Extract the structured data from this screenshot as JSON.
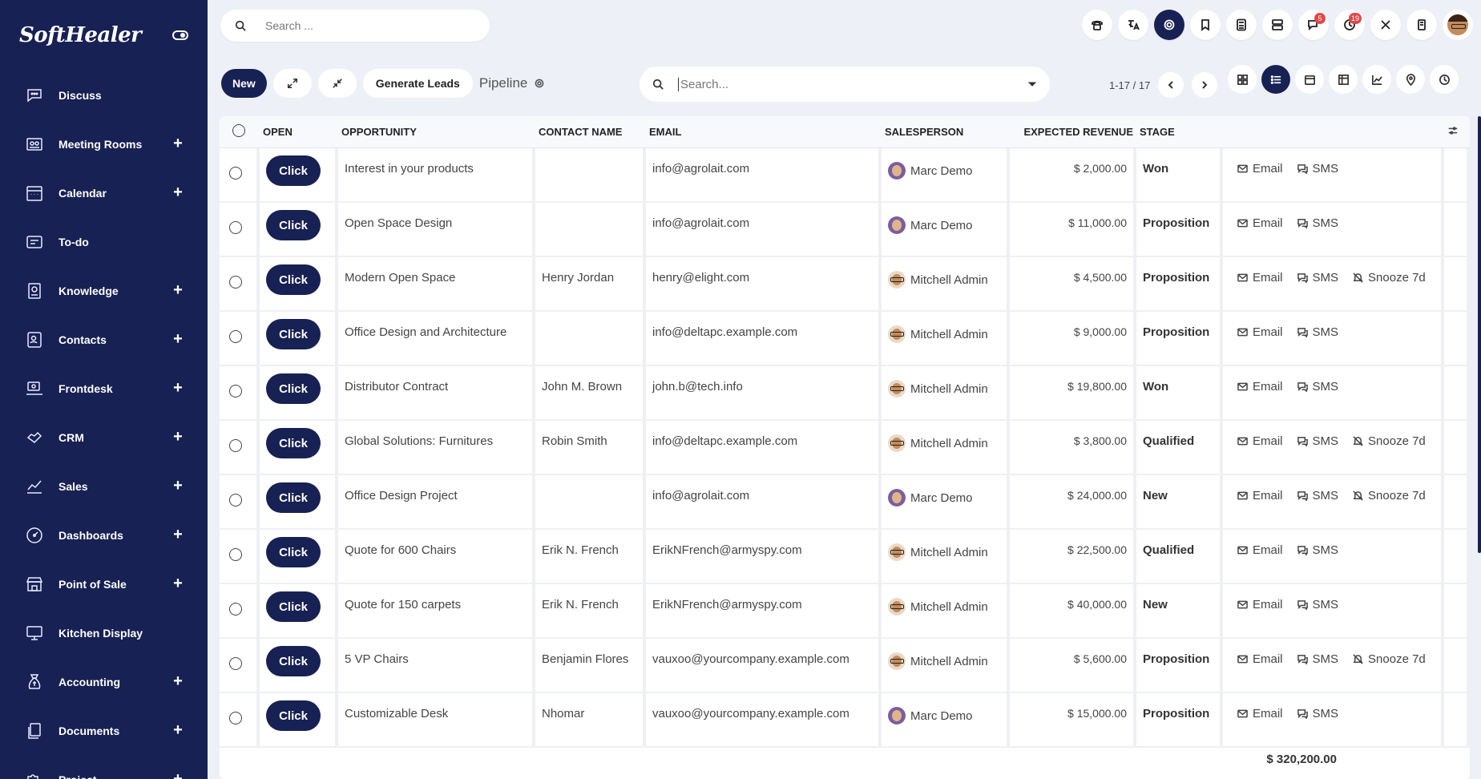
{
  "brand": {
    "logo": "SoftHealer"
  },
  "sidebar": {
    "items": [
      {
        "label": "Discuss",
        "icon": "chat-icon",
        "plus": false
      },
      {
        "label": "Meeting Rooms",
        "icon": "meeting-room-icon",
        "plus": true
      },
      {
        "label": "Calendar",
        "icon": "calendar-icon",
        "plus": true
      },
      {
        "label": "To-do",
        "icon": "todo-icon",
        "plus": false
      },
      {
        "label": "Knowledge",
        "icon": "knowledge-icon",
        "plus": true
      },
      {
        "label": "Contacts",
        "icon": "contacts-icon",
        "plus": true
      },
      {
        "label": "Frontdesk",
        "icon": "frontdesk-icon",
        "plus": true
      },
      {
        "label": "CRM",
        "icon": "crm-icon",
        "plus": true
      },
      {
        "label": "Sales",
        "icon": "sales-icon",
        "plus": true
      },
      {
        "label": "Dashboards",
        "icon": "dashboard-icon",
        "plus": true
      },
      {
        "label": "Point of Sale",
        "icon": "pos-icon",
        "plus": true
      },
      {
        "label": "Kitchen Display",
        "icon": "monitor-icon",
        "plus": false
      },
      {
        "label": "Accounting",
        "icon": "accounting-icon",
        "plus": true
      },
      {
        "label": "Documents",
        "icon": "documents-icon",
        "plus": true
      },
      {
        "label": "Project",
        "icon": "puzzle-icon",
        "plus": true
      }
    ],
    "plus_symbol": "+"
  },
  "topbar": {
    "search_placeholder": "Search ...",
    "badges": {
      "chat": "5",
      "activity": "19"
    }
  },
  "control": {
    "new_label": "New",
    "generate_leads_label": "Generate Leads",
    "pipeline_label": "Pipeline",
    "search_placeholder": "Search...",
    "pager_text": "1-17 / 17"
  },
  "table": {
    "headers": {
      "open": "OPEN",
      "opportunity": "OPPORTUNITY",
      "contact": "CONTACT NAME",
      "email": "EMAIL",
      "salesperson": "SALESPERSON",
      "revenue": "EXPECTED REVENUE",
      "stage": "STAGE"
    },
    "click_label": "Click",
    "action_labels": {
      "email": "Email",
      "sms": "SMS",
      "snooze": "Snooze 7d"
    },
    "rows": [
      {
        "opportunity": "Interest in your products",
        "contact": "",
        "email": "info@agrolait.com",
        "salesperson": "Marc Demo",
        "sp_type": "marc",
        "revenue": "$ 2,000.00",
        "stage": "Won",
        "snooze": false
      },
      {
        "opportunity": "Open Space Design",
        "contact": "",
        "email": "info@agrolait.com",
        "salesperson": "Marc Demo",
        "sp_type": "marc",
        "revenue": "$ 11,000.00",
        "stage": "Proposition",
        "snooze": false
      },
      {
        "opportunity": "Modern Open Space",
        "contact": "Henry Jordan",
        "email": "henry@elight.com",
        "salesperson": "Mitchell Admin",
        "sp_type": "mitchell",
        "revenue": "$ 4,500.00",
        "stage": "Proposition",
        "snooze": true
      },
      {
        "opportunity": "Office Design and Architecture",
        "contact": "",
        "email": "info@deltapc.example.com",
        "salesperson": "Mitchell Admin",
        "sp_type": "mitchell",
        "revenue": "$ 9,000.00",
        "stage": "Proposition",
        "snooze": false
      },
      {
        "opportunity": "Distributor Contract",
        "contact": "John M. Brown",
        "email": "john.b@tech.info",
        "salesperson": "Mitchell Admin",
        "sp_type": "mitchell",
        "revenue": "$ 19,800.00",
        "stage": "Won",
        "snooze": false
      },
      {
        "opportunity": "Global Solutions: Furnitures",
        "contact": "Robin Smith",
        "email": "info@deltapc.example.com",
        "salesperson": "Mitchell Admin",
        "sp_type": "mitchell",
        "revenue": "$ 3,800.00",
        "stage": "Qualified",
        "snooze": true
      },
      {
        "opportunity": "Office Design Project",
        "contact": "",
        "email": "info@agrolait.com",
        "salesperson": "Marc Demo",
        "sp_type": "marc",
        "revenue": "$ 24,000.00",
        "stage": "New",
        "snooze": true
      },
      {
        "opportunity": "Quote for 600 Chairs",
        "contact": "Erik N. French",
        "email": "ErikNFrench@armyspy.com",
        "salesperson": "Mitchell Admin",
        "sp_type": "mitchell",
        "revenue": "$ 22,500.00",
        "stage": "Qualified",
        "snooze": false
      },
      {
        "opportunity": "Quote for 150 carpets",
        "contact": "Erik N. French",
        "email": "ErikNFrench@armyspy.com",
        "salesperson": "Mitchell Admin",
        "sp_type": "mitchell",
        "revenue": "$ 40,000.00",
        "stage": "New",
        "snooze": false
      },
      {
        "opportunity": "5 VP Chairs",
        "contact": "Benjamin Flores",
        "email": "vauxoo@yourcompany.example.com",
        "salesperson": "Mitchell Admin",
        "sp_type": "mitchell",
        "revenue": "$ 5,600.00",
        "stage": "Proposition",
        "snooze": true
      },
      {
        "opportunity": "Customizable Desk",
        "contact": "Nhomar",
        "email": "vauxoo@yourcompany.example.com",
        "salesperson": "Marc Demo",
        "sp_type": "marc",
        "revenue": "$ 15,000.00",
        "stage": "Proposition",
        "snooze": false
      }
    ],
    "total": "$ 320,200.00"
  },
  "colors": {
    "primary": "#172154",
    "background": "#eef0f7",
    "badge": "#e04848"
  }
}
